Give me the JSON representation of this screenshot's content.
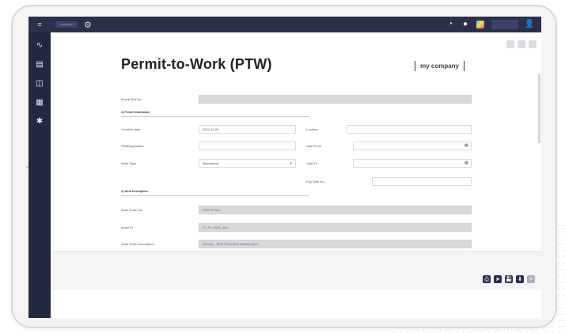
{
  "app": {
    "title": "Permit-to-Work (PTW)",
    "brand_logo_text": "my company"
  },
  "topbar": {
    "icons": [
      "menu-icon",
      "gear-icon",
      "notification-icon",
      "status-dot-icon",
      "apps-icon",
      "user-icon"
    ]
  },
  "sidebar": {
    "items": [
      {
        "icon": "activity-icon",
        "glyph": "∿"
      },
      {
        "icon": "document-icon",
        "glyph": "▤"
      },
      {
        "icon": "database-icon",
        "glyph": "◫"
      },
      {
        "icon": "book-icon",
        "glyph": "▦"
      },
      {
        "icon": "settings-icon",
        "glyph": "✱"
      }
    ]
  },
  "form": {
    "permit_ref_label": "Permit Ref No.:",
    "section1_title": "1) Permit Information",
    "section2_title": "2) Work Description",
    "creation_date_label": "Creation date",
    "creation_date_value": "2024-10-29",
    "location_label": "Location",
    "location_value": "",
    "plant_label": "Plant/Apparatus",
    "plant_value": "",
    "valid_from_label": "Valid From",
    "valid_from_value": "",
    "work_type_label": "Work Type",
    "work_type_value": "Mechanical",
    "valid_to_label": "Valid To",
    "valid_to_value": "",
    "key_safe_label": "Key Safe No.:",
    "key_safe_value": "",
    "work_order_label": "Work Order No",
    "work_order_value": "PM07R0301",
    "asset_id_label": "Asset ID",
    "asset_id_value": "P1_P1_BOIL_B44",
    "work_order_desc_label": "Work Order Description",
    "work_order_desc_value": "Monthly - BDO Preventive Maintenance"
  },
  "actions": {
    "buttons": [
      "print-icon",
      "send-icon",
      "save-icon",
      "download-icon",
      "close-icon"
    ]
  }
}
